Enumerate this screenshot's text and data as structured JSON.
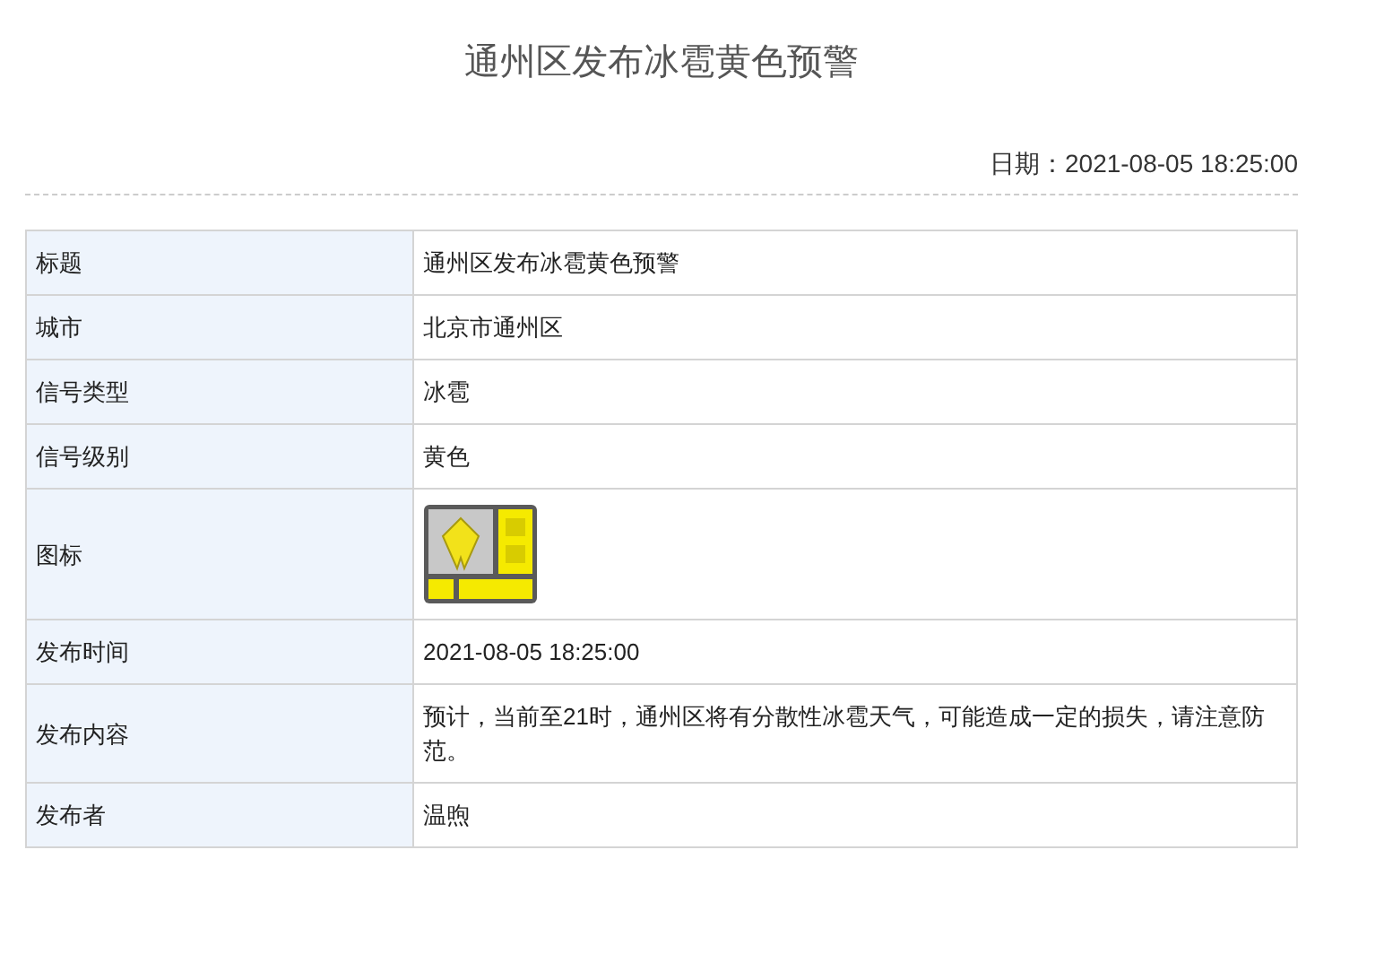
{
  "title": "通州区发布冰雹黄色预警",
  "date": {
    "label": "日期：",
    "value": "2021-08-05 18:25:00"
  },
  "table": {
    "rows": [
      {
        "kind": "text",
        "label": "标题",
        "value": "通州区发布冰雹黄色预警"
      },
      {
        "kind": "text",
        "label": "城市",
        "value": "北京市通州区"
      },
      {
        "kind": "text",
        "label": "信号类型",
        "value": "冰雹"
      },
      {
        "kind": "text",
        "label": "信号级别",
        "value": "黄色"
      },
      {
        "kind": "icon",
        "label": "图标"
      },
      {
        "kind": "text",
        "label": "发布时间",
        "value": "2021-08-05 18:25:00"
      },
      {
        "kind": "text",
        "label": "发布内容",
        "value": "预计，当前至21时，通州区将有分散性冰雹天气，可能造成一定的损失，请注意防范。"
      },
      {
        "kind": "text",
        "label": "发布者",
        "value": "温煦"
      }
    ]
  }
}
